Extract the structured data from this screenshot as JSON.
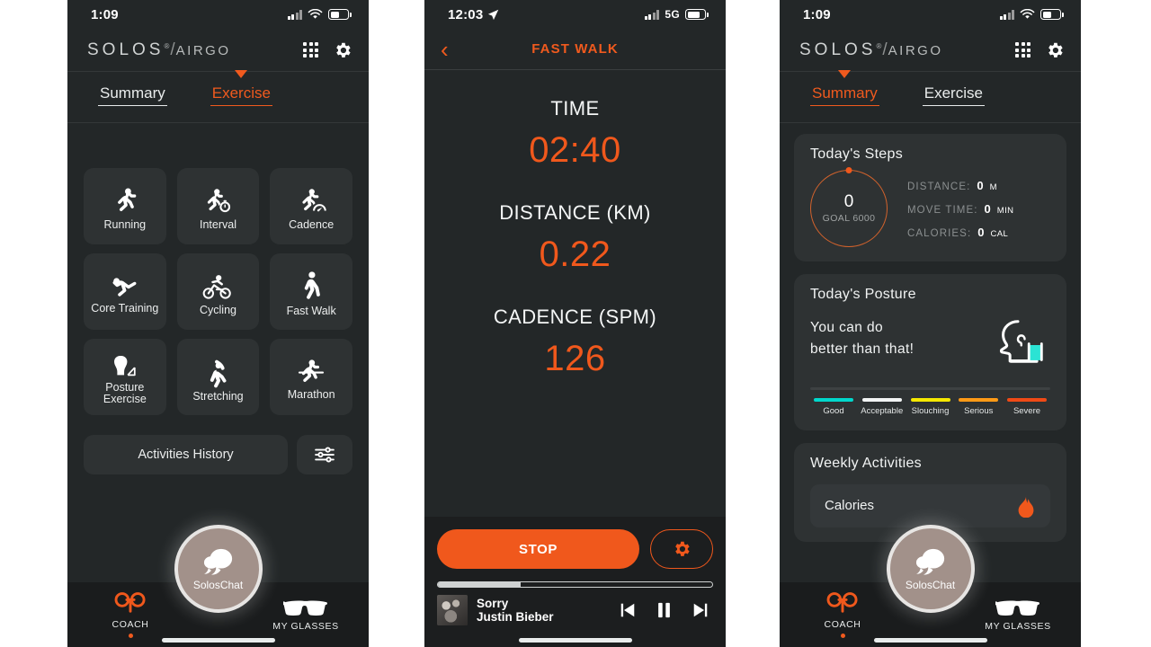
{
  "theme": {
    "accent": "#f0581c",
    "bg": "#232728",
    "tile": "#2e3233",
    "navbar": "#1a1c1d"
  },
  "phone1": {
    "status": {
      "time": "1:09",
      "battery_icon": "battery-icon",
      "wifi_icon": "wifi-icon",
      "signal_icon": "signal-icon"
    },
    "brand": {
      "part1": "SOLOS",
      "registered": "®",
      "slash": "/",
      "part2": "AIRGO"
    },
    "header_icons": {
      "grid": "grid-menu-icon",
      "settings": "gear-icon"
    },
    "tabs": [
      {
        "label": "Summary",
        "active": false
      },
      {
        "label": "Exercise",
        "active": true
      }
    ],
    "exercises": [
      {
        "label": "Running",
        "icon": "running-icon"
      },
      {
        "label": "Interval",
        "icon": "interval-stopwatch-icon"
      },
      {
        "label": "Cadence",
        "icon": "cadence-gauge-icon"
      },
      {
        "label": "Core Training",
        "icon": "core-training-icon"
      },
      {
        "label": "Cycling",
        "icon": "cycling-icon"
      },
      {
        "label": "Fast Walk",
        "icon": "fast-walk-icon"
      },
      {
        "label": "Posture Exercise",
        "icon": "posture-exercise-icon"
      },
      {
        "label": "Stretching",
        "icon": "stretching-icon"
      },
      {
        "label": "Marathon",
        "icon": "marathon-icon"
      }
    ],
    "history_button": "Activities History",
    "filter_button_icon": "sliders-filter-icon",
    "bottom_nav": {
      "left": {
        "label": "COACH",
        "icon": "coach-icon"
      },
      "center": {
        "label": "SolosChat",
        "icon": "chat-bubbles-icon"
      },
      "right": {
        "label": "MY GLASSES",
        "icon": "glasses-icon"
      }
    }
  },
  "phone2": {
    "status": {
      "time": "12:03",
      "location_icon": "location-arrow-icon",
      "network": "5G",
      "signal_icon": "signal-icon",
      "battery_icon": "battery-icon"
    },
    "navbar": {
      "back_icon": "chevron-left-icon",
      "title": "FAST WALK"
    },
    "metrics": [
      {
        "label": "TIME",
        "value": "02:40"
      },
      {
        "label": "DISTANCE (KM)",
        "value": "0.22"
      },
      {
        "label": "CADENCE (SPM)",
        "value": "126"
      }
    ],
    "controls": {
      "stop_label": "STOP",
      "settings_icon": "gear-icon"
    },
    "player": {
      "progress_percent": 30,
      "title": "Sorry",
      "artist": "Justin Bieber",
      "buttons": [
        {
          "icon": "previous-track-icon"
        },
        {
          "icon": "pause-icon"
        },
        {
          "icon": "next-track-icon"
        }
      ]
    }
  },
  "phone3": {
    "status": {
      "time": "1:09"
    },
    "brand": {
      "part1": "SOLOS",
      "registered": "®",
      "slash": "/",
      "part2": "AIRGO"
    },
    "tabs": [
      {
        "label": "Summary",
        "active": true
      },
      {
        "label": "Exercise",
        "active": false
      }
    ],
    "steps_card": {
      "title": "Today's Steps",
      "ring_value": "0",
      "ring_goal": "GOAL 6000",
      "stats": [
        {
          "key": "DISTANCE:",
          "value": "0",
          "unit": "M"
        },
        {
          "key": "MOVE TIME:",
          "value": "0",
          "unit": "MIN"
        },
        {
          "key": "CALORIES:",
          "value": "0",
          "unit": "CAL"
        }
      ]
    },
    "posture_card": {
      "title": "Today's Posture",
      "message_line1": "You can do",
      "message_line2": "better than that!",
      "icon": "posture-head-icon",
      "legend": [
        {
          "label": "Good",
          "color": "#00d8cc"
        },
        {
          "label": "Acceptable",
          "color": "#f2f4f4"
        },
        {
          "label": "Slouching",
          "color": "#f5e800"
        },
        {
          "label": "Serious",
          "color": "#ff9a16"
        },
        {
          "label": "Severe",
          "color": "#f04a16"
        }
      ]
    },
    "weekly_card": {
      "title": "Weekly Activities",
      "row_label": "Calories",
      "row_icon": "flame-icon"
    },
    "bottom_nav": {
      "left": {
        "label": "COACH",
        "icon": "coach-icon"
      },
      "center": {
        "label": "SolosChat",
        "icon": "chat-bubbles-icon"
      },
      "right": {
        "label": "MY GLASSES",
        "icon": "glasses-icon"
      }
    }
  }
}
